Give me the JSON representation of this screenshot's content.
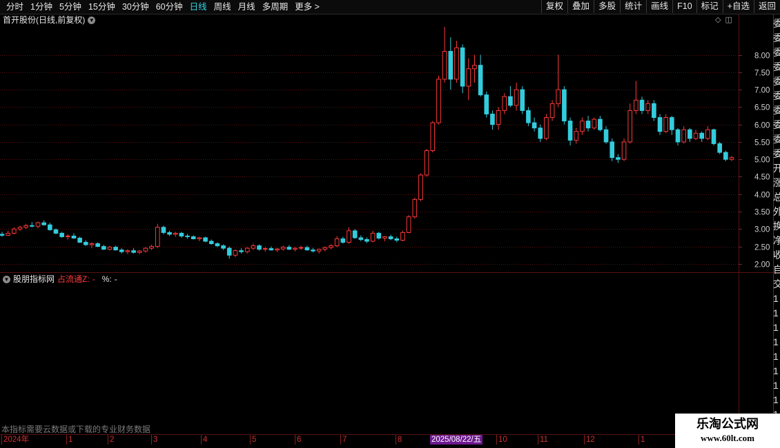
{
  "toolbar": {
    "periods": [
      "分时",
      "1分钟",
      "5分钟",
      "15分钟",
      "30分钟",
      "60分钟",
      "日线",
      "周线",
      "月线",
      "多周期",
      "更多 >"
    ],
    "active_period": "日线",
    "tools": [
      "复权",
      "叠加",
      "多股",
      "统计",
      "画线",
      "F10",
      "标记",
      "+自选",
      "返回"
    ]
  },
  "main_panel": {
    "title": "首开股份(日线,前复权)",
    "price_axis": [
      "8.00",
      "7.50",
      "7.00",
      "6.50",
      "6.00",
      "5.50",
      "5.00",
      "4.50",
      "4.00",
      "3.50",
      "3.00",
      "2.50",
      "2.00"
    ]
  },
  "indicator_panel": {
    "title": "股朋指标网",
    "label": "占流通Z:",
    "label_value": "-",
    "pct_label": "%:",
    "pct_value": "-"
  },
  "footer": {
    "note": "本指标需要云数据或下载的专业财务数据",
    "date_labels": [
      "2024年",
      "1",
      "2",
      "3",
      "4",
      "5",
      "6",
      "7",
      "8",
      "10",
      "11",
      "12",
      "1"
    ],
    "cursor_date": "2025/08/22/五"
  },
  "watermark": {
    "title": "乐淘公式网",
    "url": "www.60lt.com"
  },
  "right_strip_glyphs": [
    "委",
    "委",
    "委",
    "委",
    "委",
    "委",
    "委",
    "委",
    "委",
    "委",
    "开",
    "涨",
    "总",
    "外",
    "换",
    "净",
    "收",
    "自",
    "交",
    "1",
    "1",
    "1",
    "1",
    "1",
    "1",
    "1",
    "1",
    "1",
    "1",
    "1"
  ],
  "colors": {
    "up": "#ff3a3a",
    "down": "#33ccdd",
    "grid": "#5a1212",
    "axis_text": "#d0d0d0",
    "active_period": "#33d6e6"
  },
  "chart_data": {
    "type": "candlestick",
    "series_note": "daily K-line, approximate OHLC read from chart",
    "y_range": [
      1.8,
      8.9
    ],
    "candles": [
      [
        2.85,
        2.92,
        2.78,
        2.82
      ],
      [
        2.82,
        2.95,
        2.8,
        2.88
      ],
      [
        2.88,
        3.05,
        2.85,
        3.0
      ],
      [
        3.0,
        3.1,
        2.95,
        3.05
      ],
      [
        3.05,
        3.15,
        3.0,
        3.1
      ],
      [
        3.1,
        3.2,
        3.05,
        3.08
      ],
      [
        3.08,
        3.22,
        3.02,
        3.18
      ],
      [
        3.18,
        3.25,
        3.1,
        3.12
      ],
      [
        3.12,
        3.18,
        2.95,
        2.98
      ],
      [
        2.98,
        3.02,
        2.85,
        2.88
      ],
      [
        2.88,
        2.92,
        2.75,
        2.78
      ],
      [
        2.78,
        2.85,
        2.7,
        2.8
      ],
      [
        2.8,
        2.88,
        2.72,
        2.74
      ],
      [
        2.74,
        2.78,
        2.6,
        2.62
      ],
      [
        2.62,
        2.68,
        2.52,
        2.55
      ],
      [
        2.55,
        2.62,
        2.45,
        2.58
      ],
      [
        2.58,
        2.62,
        2.48,
        2.5
      ],
      [
        2.5,
        2.55,
        2.4,
        2.42
      ],
      [
        2.42,
        2.52,
        2.38,
        2.48
      ],
      [
        2.48,
        2.52,
        2.38,
        2.4
      ],
      [
        2.4,
        2.45,
        2.3,
        2.35
      ],
      [
        2.35,
        2.42,
        2.28,
        2.38
      ],
      [
        2.38,
        2.45,
        2.3,
        2.33
      ],
      [
        2.33,
        2.4,
        2.28,
        2.37
      ],
      [
        2.37,
        2.48,
        2.32,
        2.45
      ],
      [
        2.45,
        2.55,
        2.4,
        2.5
      ],
      [
        2.5,
        3.15,
        2.45,
        3.05
      ],
      [
        3.05,
        3.1,
        2.85,
        2.9
      ],
      [
        2.9,
        2.95,
        2.8,
        2.85
      ],
      [
        2.85,
        2.92,
        2.78,
        2.88
      ],
      [
        2.88,
        2.92,
        2.75,
        2.8
      ],
      [
        2.8,
        2.86,
        2.72,
        2.78
      ],
      [
        2.78,
        2.82,
        2.7,
        2.72
      ],
      [
        2.72,
        2.78,
        2.65,
        2.75
      ],
      [
        2.75,
        2.78,
        2.62,
        2.65
      ],
      [
        2.65,
        2.7,
        2.55,
        2.58
      ],
      [
        2.58,
        2.62,
        2.48,
        2.52
      ],
      [
        2.52,
        2.56,
        2.4,
        2.45
      ],
      [
        2.45,
        2.5,
        2.15,
        2.25
      ],
      [
        2.25,
        2.42,
        2.2,
        2.38
      ],
      [
        2.38,
        2.45,
        2.3,
        2.35
      ],
      [
        2.35,
        2.48,
        2.3,
        2.45
      ],
      [
        2.45,
        2.58,
        2.4,
        2.52
      ],
      [
        2.52,
        2.56,
        2.38,
        2.42
      ],
      [
        2.42,
        2.48,
        2.35,
        2.44
      ],
      [
        2.44,
        2.5,
        2.38,
        2.4
      ],
      [
        2.4,
        2.46,
        2.34,
        2.43
      ],
      [
        2.43,
        2.52,
        2.38,
        2.48
      ],
      [
        2.48,
        2.54,
        2.4,
        2.42
      ],
      [
        2.42,
        2.48,
        2.36,
        2.45
      ],
      [
        2.45,
        2.52,
        2.4,
        2.47
      ],
      [
        2.47,
        2.52,
        2.38,
        2.4
      ],
      [
        2.4,
        2.46,
        2.33,
        2.37
      ],
      [
        2.37,
        2.44,
        2.3,
        2.42
      ],
      [
        2.42,
        2.5,
        2.36,
        2.47
      ],
      [
        2.47,
        2.56,
        2.42,
        2.52
      ],
      [
        2.52,
        2.8,
        2.48,
        2.72
      ],
      [
        2.72,
        2.78,
        2.58,
        2.62
      ],
      [
        2.62,
        3.05,
        2.58,
        2.95
      ],
      [
        2.95,
        3.0,
        2.72,
        2.75
      ],
      [
        2.75,
        2.82,
        2.65,
        2.7
      ],
      [
        2.7,
        2.76,
        2.6,
        2.65
      ],
      [
        2.65,
        2.95,
        2.62,
        2.88
      ],
      [
        2.88,
        2.92,
        2.7,
        2.74
      ],
      [
        2.74,
        2.8,
        2.65,
        2.78
      ],
      [
        2.78,
        2.84,
        2.68,
        2.72
      ],
      [
        2.72,
        2.78,
        2.62,
        2.68
      ],
      [
        2.68,
        2.95,
        2.65,
        2.9
      ],
      [
        2.9,
        3.4,
        2.88,
        3.35
      ],
      [
        3.35,
        3.9,
        3.3,
        3.85
      ],
      [
        3.85,
        4.6,
        3.8,
        4.55
      ],
      [
        4.55,
        5.3,
        4.5,
        5.25
      ],
      [
        5.25,
        6.1,
        5.2,
        6.05
      ],
      [
        6.05,
        7.4,
        6.0,
        7.3
      ],
      [
        7.3,
        8.8,
        7.2,
        8.1
      ],
      [
        8.1,
        8.5,
        7.0,
        7.3
      ],
      [
        7.3,
        8.4,
        7.2,
        8.2
      ],
      [
        8.2,
        8.3,
        6.9,
        7.1
      ],
      [
        7.1,
        7.9,
        6.7,
        7.6
      ],
      [
        7.6,
        8.0,
        7.2,
        7.7
      ],
      [
        7.7,
        8.0,
        6.8,
        6.85
      ],
      [
        6.85,
        6.95,
        6.2,
        6.3
      ],
      [
        6.3,
        6.4,
        5.85,
        6.0
      ],
      [
        6.0,
        6.5,
        5.85,
        6.4
      ],
      [
        6.4,
        6.9,
        6.3,
        6.8
      ],
      [
        6.8,
        7.1,
        6.5,
        6.55
      ],
      [
        6.55,
        7.2,
        6.4,
        7.0
      ],
      [
        7.0,
        7.1,
        6.3,
        6.4
      ],
      [
        6.4,
        6.5,
        5.95,
        6.05
      ],
      [
        6.05,
        6.2,
        5.8,
        5.9
      ],
      [
        5.9,
        6.0,
        5.5,
        5.6
      ],
      [
        5.6,
        6.3,
        5.55,
        6.2
      ],
      [
        6.2,
        6.7,
        6.1,
        6.6
      ],
      [
        6.6,
        8.0,
        6.5,
        7.0
      ],
      [
        7.0,
        7.1,
        6.0,
        6.1
      ],
      [
        6.1,
        6.2,
        5.4,
        5.55
      ],
      [
        5.55,
        5.9,
        5.45,
        5.8
      ],
      [
        5.8,
        6.2,
        5.7,
        6.1
      ],
      [
        6.1,
        6.25,
        5.8,
        5.9
      ],
      [
        5.9,
        6.2,
        5.85,
        6.15
      ],
      [
        6.15,
        6.25,
        5.8,
        5.85
      ],
      [
        5.85,
        5.95,
        5.45,
        5.5
      ],
      [
        5.5,
        5.6,
        4.95,
        5.05
      ],
      [
        5.05,
        5.15,
        4.9,
        5.0
      ],
      [
        5.0,
        5.6,
        4.95,
        5.5
      ],
      [
        5.5,
        6.6,
        5.45,
        6.4
      ],
      [
        6.4,
        7.25,
        6.3,
        6.7
      ],
      [
        6.7,
        6.8,
        6.3,
        6.4
      ],
      [
        6.4,
        6.7,
        6.3,
        6.6
      ],
      [
        6.6,
        6.7,
        6.1,
        6.2
      ],
      [
        6.2,
        6.3,
        5.7,
        5.8
      ],
      [
        5.8,
        6.3,
        5.75,
        6.2
      ],
      [
        6.2,
        6.25,
        5.7,
        5.85
      ],
      [
        5.85,
        5.9,
        5.4,
        5.5
      ],
      [
        5.5,
        5.95,
        5.45,
        5.85
      ],
      [
        5.85,
        5.9,
        5.5,
        5.6
      ],
      [
        5.6,
        5.85,
        5.55,
        5.75
      ],
      [
        5.75,
        5.8,
        5.5,
        5.6
      ],
      [
        5.6,
        5.95,
        5.55,
        5.85
      ],
      [
        5.85,
        5.88,
        5.4,
        5.45
      ],
      [
        5.45,
        5.5,
        5.15,
        5.2
      ],
      [
        5.2,
        5.25,
        4.95,
        5.0
      ],
      [
        5.0,
        5.1,
        4.95,
        5.05
      ]
    ]
  }
}
